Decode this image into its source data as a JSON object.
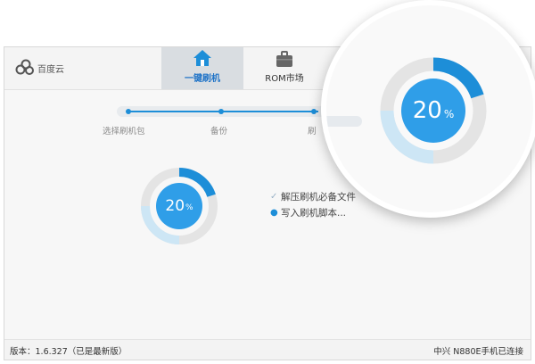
{
  "app": {
    "brand": "百度云",
    "tabs": [
      {
        "label": "一键刷机",
        "active": true,
        "icon": "home-icon"
      },
      {
        "label": "ROM市场",
        "active": false,
        "icon": "briefcase-icon"
      }
    ],
    "close_glyph": "✕"
  },
  "stepper": {
    "steps": [
      "选择刷机包",
      "备份",
      "刷"
    ]
  },
  "progress": {
    "percent_value": 20,
    "percent_text": "20",
    "percent_sign": "%",
    "accent": "#1d8ed8",
    "track": "#e4e4e4",
    "inner_color": "#2f9ee8"
  },
  "tasks": [
    {
      "status": "done",
      "text": "解压刷机必备文件"
    },
    {
      "status": "active",
      "text": "写入刷机脚本..."
    }
  ],
  "statusbar": {
    "version": "版本：1.6.327（已是最新版）",
    "device": "中兴 N880E手机已连接"
  }
}
